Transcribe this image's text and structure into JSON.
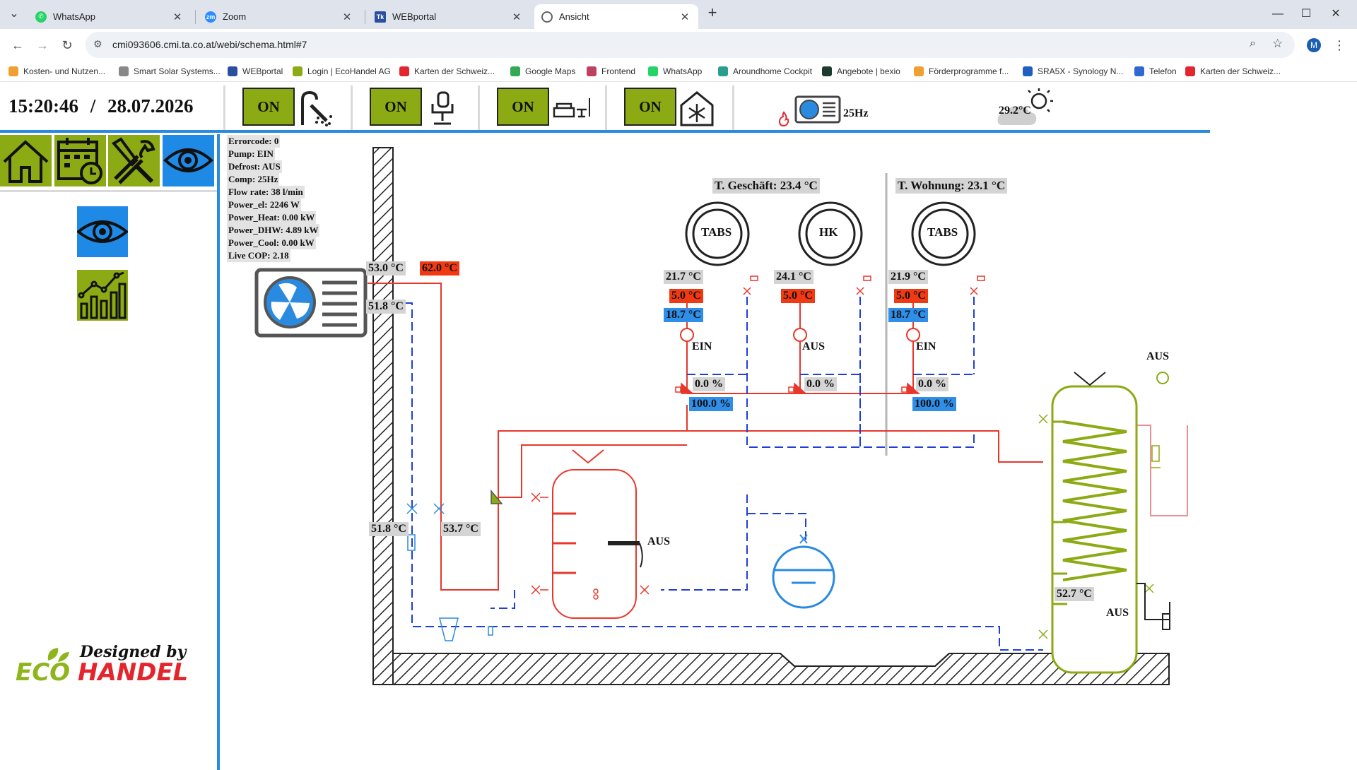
{
  "browser": {
    "tabs": [
      {
        "title": "WhatsApp",
        "icon": "whatsapp-icon",
        "color": "#25d366"
      },
      {
        "title": "Zoom",
        "icon": "zoom-icon",
        "color": "#2d8cff"
      },
      {
        "title": "WEBportal",
        "icon": "webportal-icon",
        "color": "#2b4fa0"
      },
      {
        "title": "Ansicht",
        "icon": "globe-icon",
        "color": "#5f6368"
      }
    ],
    "new_tab_label": "+",
    "url": "cmi093606.cmi.ta.co.at/webi/schema.html#7",
    "profile_initial": "M",
    "bookmarks": [
      {
        "label": "Kosten- und Nutzen...",
        "color": "#f0a030"
      },
      {
        "label": "Smart Solar Systems...",
        "color": "#888888"
      },
      {
        "label": "WEBportal",
        "color": "#2b4fa0"
      },
      {
        "label": "Login | EcoHandel AG",
        "color": "#8caa14"
      },
      {
        "label": "Karten der Schweiz...",
        "color": "#e3262e"
      },
      {
        "label": "Google Maps",
        "color": "#34a853"
      },
      {
        "label": "Frontend",
        "color": "#c04060"
      },
      {
        "label": "WhatsApp",
        "color": "#25d366"
      },
      {
        "label": "Aroundhome Cockpit",
        "color": "#2a9d8f"
      },
      {
        "label": "Angebote | bexio",
        "color": "#1d3a2f"
      },
      {
        "label": "Förderprogramme f...",
        "color": "#f0a030"
      },
      {
        "label": "SRA5X - Synology N...",
        "color": "#1f5fbf"
      },
      {
        "label": "Telefon",
        "color": "#3067d0"
      },
      {
        "label": "Karten der Schweiz...",
        "color": "#e3262e"
      }
    ]
  },
  "header": {
    "time": "15:20:46",
    "separator": "/",
    "date": "28.07.2026",
    "switches": [
      {
        "label": "ON",
        "icon": "shower-icon"
      },
      {
        "label": "ON",
        "icon": "chair-icon"
      },
      {
        "label": "ON",
        "icon": "lounge-icon"
      },
      {
        "label": "ON",
        "icon": "snowflake-icon"
      }
    ],
    "compressor_freq": "25Hz",
    "outdoor_temp": "29.2°C"
  },
  "status": {
    "lines": [
      "Errorcode: 0",
      "Pump: EIN",
      "Defrost: AUS",
      "Comp: 25Hz",
      "Flow rate: 38 l/min",
      "Power_el: 2246 W",
      "Power_Heat: 0.00 kW",
      "Power_DHW: 4.89 kW",
      "Power_Cool: 0.00 kW",
      "Live COP: 2.18"
    ]
  },
  "schema": {
    "hp_out_temp": "53.0 °C",
    "hp_out_set": "62.0 °C",
    "hp_return_temp": "51.8 °C",
    "return_lower_temp": "51.8 °C",
    "flow_lower_temp": "53.7 °C",
    "buffer_heater": "AUS",
    "t_business": "T. Geschäft: 23.4 °C",
    "t_apartment": "T. Wohnung: 23.1 °C",
    "circuits": [
      {
        "name": "TABS",
        "flow_temp": "21.7 °C",
        "set_red": "5.0 °C",
        "set_blue": "18.7 °C",
        "pump": "EIN",
        "mix": "0.0 %",
        "mix2": "100.0 %"
      },
      {
        "name": "HK",
        "flow_temp": "24.1 °C",
        "set_red": "5.0 °C",
        "pump": "AUS",
        "mix": "0.0 %"
      },
      {
        "name": "TABS",
        "flow_temp": "21.9 °C",
        "set_red": "5.0 °C",
        "set_blue": "18.7 °C",
        "pump": "EIN",
        "mix": "0.0 %",
        "mix2": "100.0 %"
      }
    ],
    "dhw_circ_pump": "AUS",
    "dhw_temp": "52.7 °C",
    "dhw_heater": "AUS"
  },
  "branding": {
    "designed_by": "Designed by",
    "eco": "ECO",
    "handel": "HANDEL"
  },
  "colors": {
    "accent_green": "#8caa14",
    "accent_blue": "#1f8ae6",
    "hot_pipe": "#e8372a",
    "cold_pipe": "#1f3fd6"
  }
}
